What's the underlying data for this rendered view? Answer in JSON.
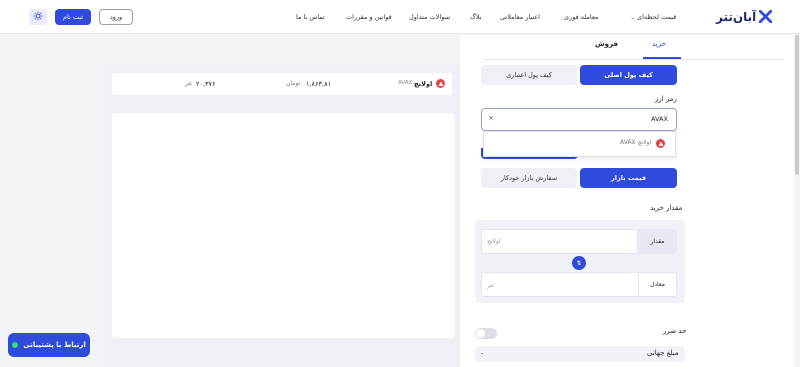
{
  "header": {
    "logo_text": "آبان‌تتر",
    "nav": [
      {
        "label": "قیمت لحظه‌ای"
      },
      {
        "label": "معامله فوری"
      },
      {
        "label": "اعتبار معاملاتی"
      },
      {
        "label": "بلاگ"
      },
      {
        "label": "سوالات متداول"
      },
      {
        "label": "قوانین و مقررات"
      },
      {
        "label": "تماس با ما"
      }
    ],
    "signup_label": "ثبت نام",
    "login_label": "ورود"
  },
  "trade": {
    "tab_buy": "خرید",
    "tab_sell": "فروش",
    "wallet_main": "کیف پول اصلی",
    "wallet_credit": "کیف پول اعتباری",
    "currency_label": "رمز ارز",
    "selected_currency": "AVAX",
    "dropdown_option": "اولانچ AVAX",
    "market_price": "قیمت بازار",
    "limit_order": "سفارش بازار خودکار",
    "amount_label": "مقدار خرید",
    "amount_field_label": "مقدار",
    "amount_placeholder": "اولانچ",
    "equivalent_label": "معادل",
    "equivalent_placeholder": "تتر",
    "stop_loss_label": "حد ضرر",
    "total_label": "مبلغ جهانی",
    "total_value": "-"
  },
  "ticker": {
    "coin_name": "اولانچ",
    "symbol": "AVAX",
    "toman_price": "۱,۸۶۳,۸۱",
    "toman_unit": "تومان",
    "tether_price": "۲۰,۳۷۶",
    "tether_unit": "تتر"
  },
  "support": {
    "label": "ارتباط با پشتیبانی"
  },
  "colors": {
    "primary": "#2f4bdb",
    "avax": "#e84142",
    "online": "#2ee06a"
  }
}
